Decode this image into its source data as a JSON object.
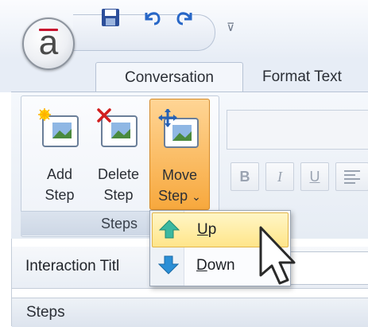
{
  "app": {
    "orb_glyph": "a"
  },
  "quick_access": {
    "save_icon": "save-icon",
    "undo_icon": "undo-icon",
    "redo_icon": "redo-icon",
    "more_icon": "customize-icon",
    "more_glyph": "⊽"
  },
  "tabs": [
    {
      "label": "Conversation",
      "active": true
    },
    {
      "label": "Format Text",
      "active": false
    }
  ],
  "steps_group": {
    "label": "Steps",
    "buttons": [
      {
        "line1": "Add",
        "line2": "Step",
        "icon": "add-step-icon"
      },
      {
        "line1": "Delete",
        "line2": "Step",
        "icon": "delete-step-icon"
      },
      {
        "line1": "Move",
        "line2": "Step",
        "icon": "move-step-icon",
        "has_dropdown": true,
        "dropdown_glyph": "⌄"
      }
    ]
  },
  "format_group": {
    "bold": "B",
    "italic": "I",
    "underline": "U"
  },
  "move_menu": {
    "items": [
      {
        "label": "Up",
        "accel": "U",
        "rest": "p",
        "icon": "arrow-up-icon"
      },
      {
        "label": "Down",
        "accel": "D",
        "rest": "own",
        "icon": "arrow-down-icon"
      }
    ]
  },
  "interaction": {
    "label": "Interaction Titl",
    "value": ""
  },
  "steps_panel": {
    "title": "Steps"
  },
  "colors": {
    "accent_orange": "#f7a83d",
    "menu_highlight": "#ffe58a",
    "arrow_green": "#3cb8a0",
    "arrow_blue": "#2b8fd6"
  }
}
